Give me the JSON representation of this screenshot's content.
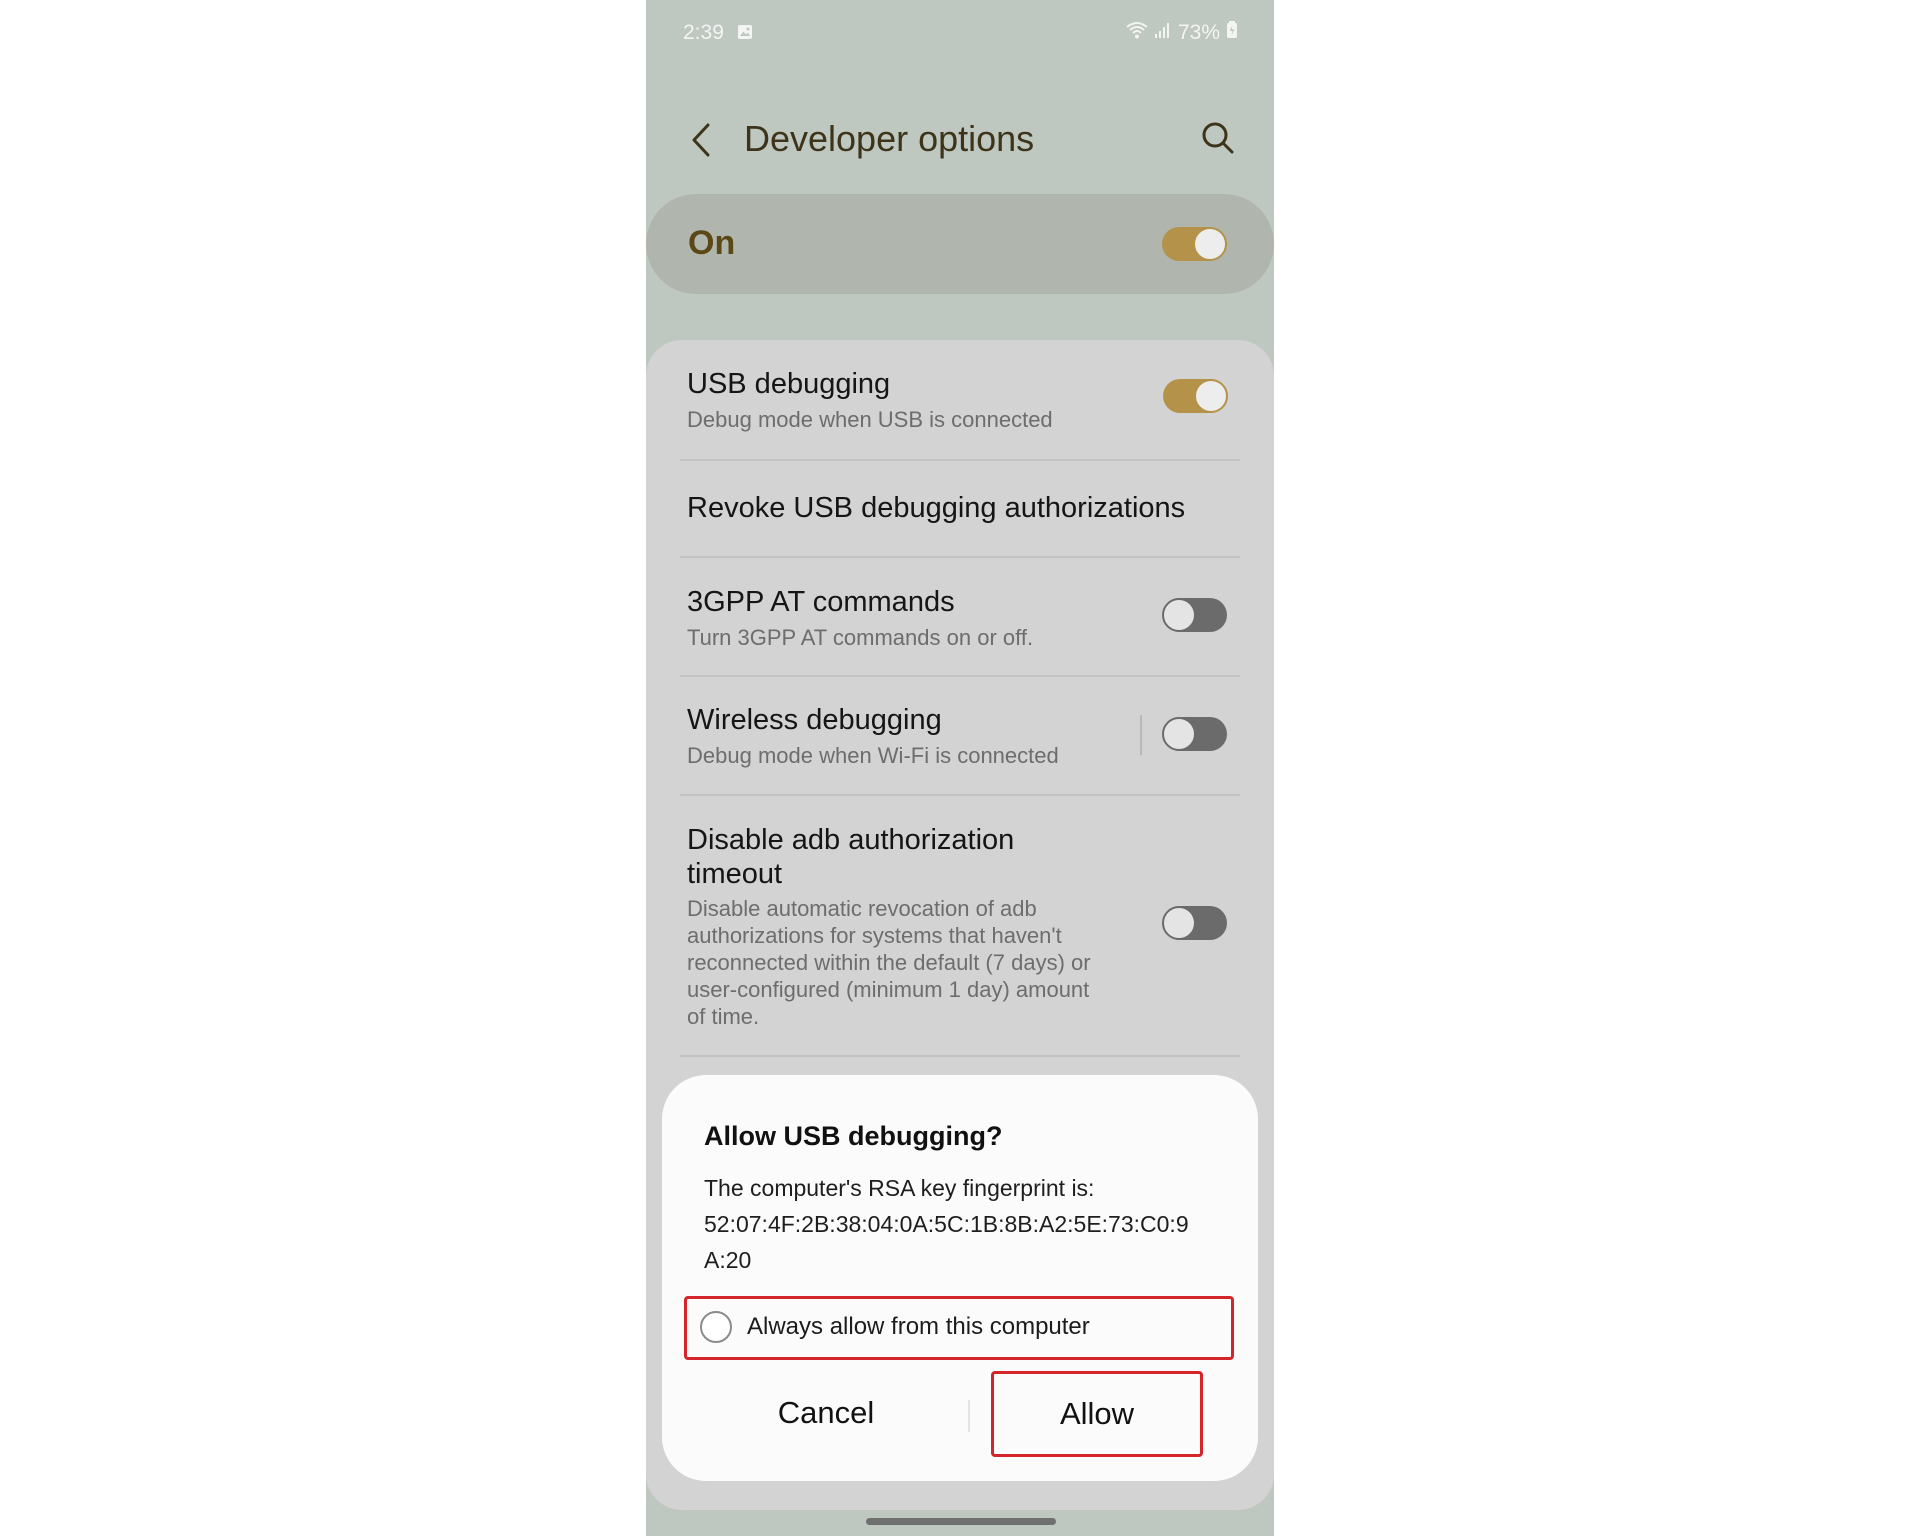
{
  "status_bar": {
    "time": "2:39",
    "battery": "73%",
    "icons": [
      "gallery-icon",
      "wifi-icon",
      "signal-icon",
      "battery-icon"
    ]
  },
  "app_bar": {
    "title": "Developer options",
    "icons": [
      "back-icon",
      "search-icon"
    ]
  },
  "master_toggle": {
    "label": "On",
    "state": "on"
  },
  "settings": [
    {
      "title": "USB debugging",
      "subtitle": "Debug mode when USB is connected",
      "toggle": "on"
    },
    {
      "title": "Revoke USB debugging authorizations"
    },
    {
      "title": "3GPP AT commands",
      "subtitle": "Turn 3GPP AT commands on or off.",
      "toggle": "off"
    },
    {
      "title": "Wireless debugging",
      "subtitle": "Debug mode when Wi-Fi is connected",
      "toggle": "off"
    },
    {
      "title_lines": [
        "Disable adb authorization",
        "timeout"
      ],
      "subtitle_lines": [
        "Disable automatic revocation of adb",
        "authorizations for systems that haven't",
        "reconnected within the default (7 days) or",
        "user-configured (minimum 1 day) amount",
        "of time."
      ],
      "toggle": "off"
    }
  ],
  "dialog": {
    "title": "Allow USB debugging?",
    "body_lines": [
      "The computer's RSA key fingerprint is:",
      "52:07:4F:2B:38:04:0A:5C:1B:8B:A2:5E:73:C0:9",
      "A:20"
    ],
    "checkbox_label": "Always allow from this computer",
    "checkbox_checked": false,
    "cancel_label": "Cancel",
    "allow_label": "Allow"
  },
  "colors": {
    "accent": "#b5924a",
    "background": "#bfc7c1",
    "highlight_border": "#d4252b"
  }
}
